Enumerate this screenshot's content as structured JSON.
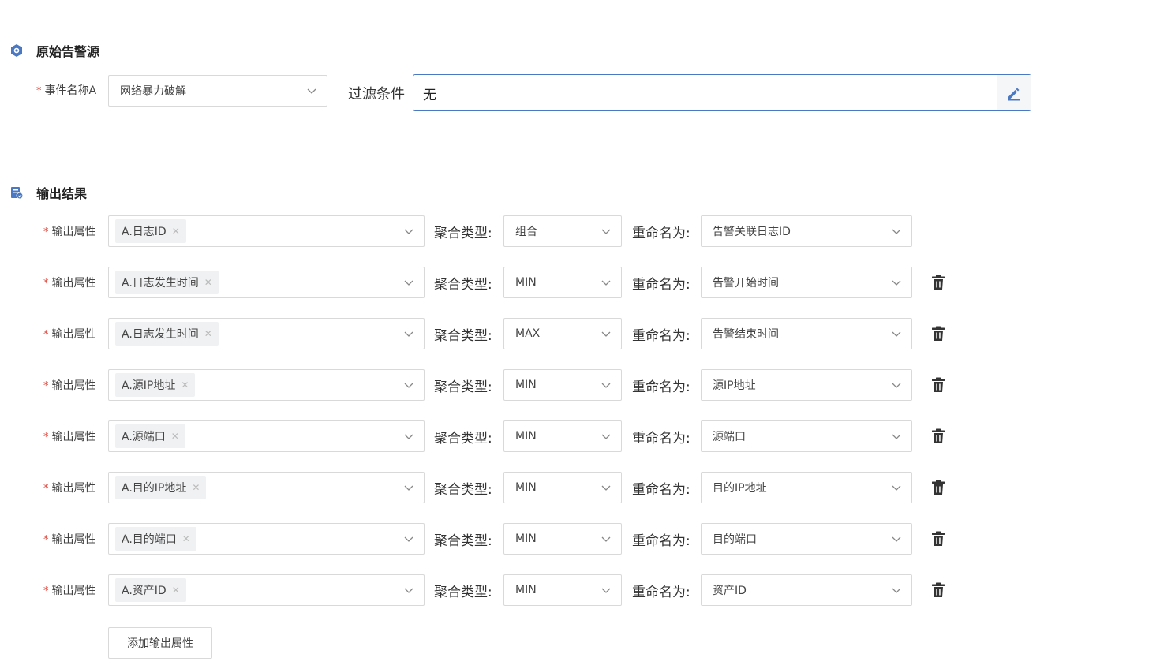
{
  "source_section": {
    "title": "原始告警源",
    "event_label": "事件名称A",
    "event_value": "网络暴力破解",
    "filter_label": "过滤条件",
    "filter_value": "无"
  },
  "output_section": {
    "title": "输出结果",
    "attr_label": "输出属性",
    "agg_label": "聚合类型:",
    "rename_label": "重命名为:",
    "rows": [
      {
        "attr": "A.日志ID",
        "agg": "组合",
        "rename": "告警关联日志ID",
        "deletable": false
      },
      {
        "attr": "A.日志发生时间",
        "agg": "MIN",
        "rename": "告警开始时间",
        "deletable": true
      },
      {
        "attr": "A.日志发生时间",
        "agg": "MAX",
        "rename": "告警结束时间",
        "deletable": true
      },
      {
        "attr": "A.源IP地址",
        "agg": "MIN",
        "rename": "源IP地址",
        "deletable": true
      },
      {
        "attr": "A.源端口",
        "agg": "MIN",
        "rename": "源端口",
        "deletable": true
      },
      {
        "attr": "A.目的IP地址",
        "agg": "MIN",
        "rename": "目的IP地址",
        "deletable": true
      },
      {
        "attr": "A.目的端口",
        "agg": "MIN",
        "rename": "目的端口",
        "deletable": true
      },
      {
        "attr": "A.资产ID",
        "agg": "MIN",
        "rename": "资产ID",
        "deletable": true
      }
    ],
    "add_button": "添加输出属性"
  },
  "colors": {
    "accent": "#4a78c2",
    "required": "#e0443a"
  }
}
